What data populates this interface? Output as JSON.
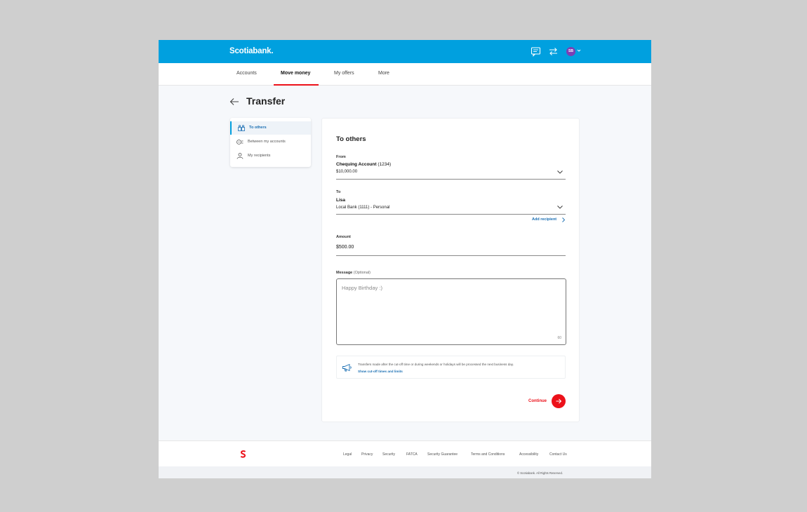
{
  "header": {
    "logo_text": "Scotiabank.",
    "avatar_initials": "SB",
    "brand_color": "#00a0df",
    "accent_color": "#ec111a"
  },
  "nav": {
    "items": [
      {
        "label": "Accounts"
      },
      {
        "label": "Move money",
        "active": true
      },
      {
        "label": "My offers"
      },
      {
        "label": "More"
      }
    ]
  },
  "page": {
    "title": "Transfer"
  },
  "side_menu": {
    "items": [
      {
        "label": "To others",
        "icon": "people-icon",
        "active": true
      },
      {
        "label": "Between my accounts",
        "icon": "accounts-swap-icon"
      },
      {
        "label": "My recipients",
        "icon": "person-icon"
      }
    ]
  },
  "form": {
    "title": "To others",
    "from": {
      "label": "From",
      "account_name": "Chequing Account",
      "account_number": "(1234)",
      "balance": "$10,000.00"
    },
    "to": {
      "label": "To",
      "recipient_name": "Lisa",
      "recipient_detail": "Local Bank (1111) - Personal",
      "add_recipient": "Add recipient"
    },
    "amount": {
      "label": "Amount",
      "value": "$500.00"
    },
    "message": {
      "label": "Message",
      "optional": "(Optional)",
      "placeholder": "Happy Birthday :)",
      "char_count": "60"
    },
    "notice": {
      "text": "Transfers made after the cut-off time or during weekends or holidays will be processed the next business day.",
      "link": "Show cut-off times and limits"
    },
    "continue_label": "Continue"
  },
  "footer": {
    "links": [
      "Legal",
      "Privacy",
      "Security",
      "FATCA",
      "Security Guarantee",
      "Terms and Conditions",
      "Accessibility",
      "Contact Us"
    ],
    "copyright": "© Scotiabank. All Rights Reserved."
  }
}
